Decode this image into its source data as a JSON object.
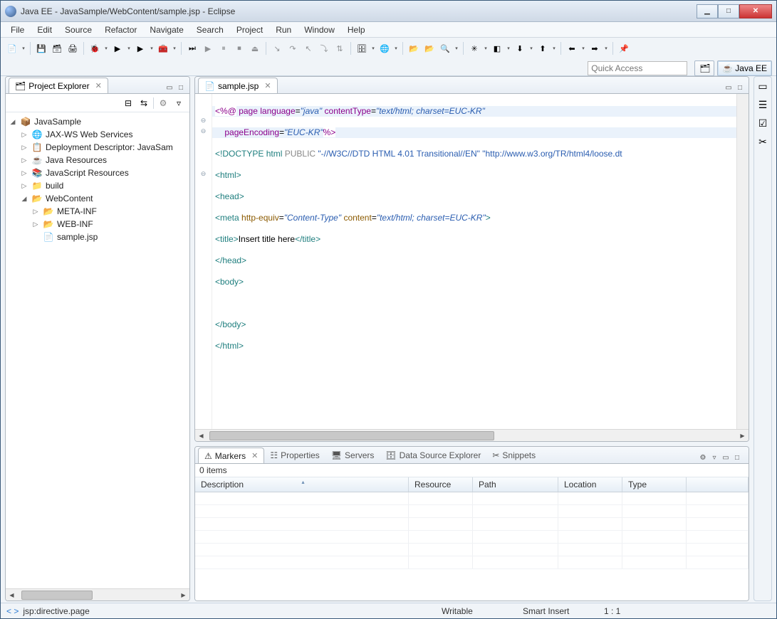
{
  "title": "Java EE - JavaSample/WebContent/sample.jsp - Eclipse",
  "menu": [
    "File",
    "Edit",
    "Source",
    "Refactor",
    "Navigate",
    "Search",
    "Project",
    "Run",
    "Window",
    "Help"
  ],
  "quick_access_placeholder": "Quick Access",
  "perspective_label": "Java EE",
  "project_explorer_title": "Project Explorer",
  "tree": {
    "root": "JavaSample",
    "children": [
      "JAX-WS Web Services",
      "Deployment Descriptor: JavaSam",
      "Java Resources",
      "JavaScript Resources",
      "build",
      "WebContent"
    ],
    "webcontent_children": [
      "META-INF",
      "WEB-INF",
      "sample.jsp"
    ]
  },
  "editor_tab": "sample.jsp",
  "doctype_text": "\"-//W3C//DTD HTML 4.01 Transitional//EN\"",
  "doctype_url": "\"http://www.w3.org/TR/html4/loose.dt",
  "title_text": "Insert title here",
  "bottom_tabs": {
    "markers": "Markers",
    "properties": "Properties",
    "servers": "Servers",
    "dse": "Data Source Explorer",
    "snippets": "Snippets"
  },
  "items_label": "0 items",
  "columns": {
    "description": "Description",
    "resource": "Resource",
    "path": "Path",
    "location": "Location",
    "type": "Type"
  },
  "status": {
    "context": "jsp:directive.page",
    "writable": "Writable",
    "insert": "Smart Insert",
    "pos": "1 : 1"
  }
}
